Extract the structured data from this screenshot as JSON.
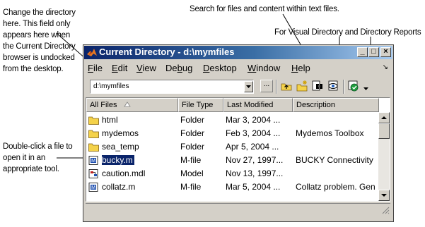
{
  "annotations": {
    "directory_note": "Change the directory here. This field only appears here when the Current Directory browser is undocked from the desktop.",
    "search_note": "Search for files and content within text files.",
    "reports_note": "For Visual Directory and Directory Reports",
    "doubleclick_note": "Double-click a file to open it in an appropriate tool."
  },
  "window": {
    "title": "Current Directory - d:\\mymfiles",
    "controls": {
      "minimize": "_",
      "maximize": "□",
      "close": "×"
    }
  },
  "menus": [
    {
      "pre": "",
      "u": "F",
      "post": "ile"
    },
    {
      "pre": "",
      "u": "E",
      "post": "dit"
    },
    {
      "pre": "",
      "u": "V",
      "post": "iew"
    },
    {
      "pre": "De",
      "u": "b",
      "post": "ug"
    },
    {
      "pre": "",
      "u": "D",
      "post": "esktop"
    },
    {
      "pre": "",
      "u": "W",
      "post": "indow"
    },
    {
      "pre": "",
      "u": "H",
      "post": "elp"
    }
  ],
  "toolbar": {
    "path_value": "d:\\mymfiles",
    "browse_label": "...",
    "icons": [
      "up-folder-icon",
      "new-folder-icon",
      "find-files-icon",
      "visual-directory-icon",
      "directory-reports-icon"
    ]
  },
  "columns": {
    "name": "All Files",
    "type": "File Type",
    "modified": "Last Modified",
    "description": "Description"
  },
  "files": [
    {
      "name": "html",
      "type": "Folder",
      "modified": "Mar 3, 2004 ...",
      "description": "",
      "icon": "folder-icon",
      "selected": false
    },
    {
      "name": "mydemos",
      "type": "Folder",
      "modified": "Feb 3, 2004 ...",
      "description": "Mydemos Toolbox",
      "icon": "folder-icon",
      "selected": false
    },
    {
      "name": "sea_temp",
      "type": "Folder",
      "modified": "Apr 5, 2004 ...",
      "description": "",
      "icon": "folder-icon",
      "selected": false
    },
    {
      "name": "bucky.m",
      "type": "M-file",
      "modified": "Nov 27, 1997...",
      "description": "BUCKY  Connectivity",
      "icon": "m-file-icon",
      "selected": true
    },
    {
      "name": "caution.mdl",
      "type": "Model",
      "modified": "Nov 13, 1997...",
      "description": "",
      "icon": "model-file-icon",
      "selected": false
    },
    {
      "name": "collatz.m",
      "type": "M-file",
      "modified": "Mar 5, 2004 ...",
      "description": "Collatz problem. Gen",
      "icon": "m-file-icon",
      "selected": false
    }
  ],
  "colors": {
    "title_start": "#0a246a",
    "title_end": "#a6caf0",
    "selection": "#0a246a",
    "chrome": "#d4d0c8"
  }
}
